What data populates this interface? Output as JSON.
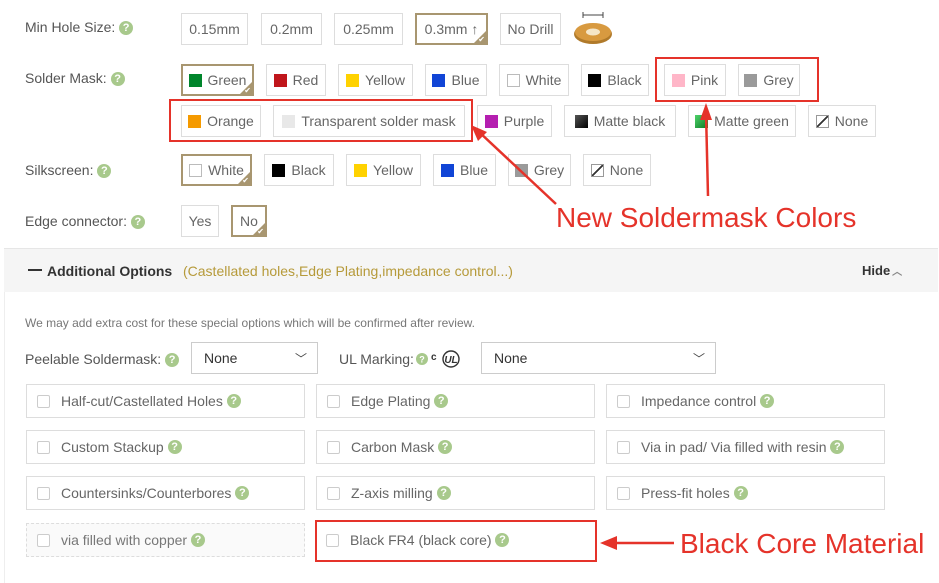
{
  "min_hole": {
    "label": "Min Hole Size:",
    "options": [
      "0.15mm",
      "0.2mm",
      "0.25mm",
      "0.3mm ↑",
      "No Drill"
    ],
    "selected": "0.3mm ↑"
  },
  "solder_mask": {
    "label": "Solder Mask:",
    "options": [
      {
        "label": "Green",
        "color": "#00852b"
      },
      {
        "label": "Red",
        "color": "#c0161b"
      },
      {
        "label": "Yellow",
        "color": "#ffd200"
      },
      {
        "label": "Blue",
        "color": "#1145d6"
      },
      {
        "label": "White",
        "color": "#ffffff"
      },
      {
        "label": "Black",
        "color": "#000000"
      },
      {
        "label": "Pink",
        "color": "#ffb6c8"
      },
      {
        "label": "Grey",
        "color": "#9a9a9a"
      },
      {
        "label": "Orange",
        "color": "#f59a00"
      },
      {
        "label": "Transparent solder mask",
        "color": "#e8e8e8"
      },
      {
        "label": "Purple",
        "color": "#b51fb0"
      },
      {
        "label": "Matte black",
        "color": "#1b1b1b"
      },
      {
        "label": "Matte green",
        "color": "#1fa33a"
      },
      {
        "label": "None",
        "color": "none"
      }
    ],
    "selected": "Green"
  },
  "silkscreen": {
    "label": "Silkscreen:",
    "options": [
      {
        "label": "White",
        "color": "#ffffff"
      },
      {
        "label": "Black",
        "color": "#000000"
      },
      {
        "label": "Yellow",
        "color": "#ffd200"
      },
      {
        "label": "Blue",
        "color": "#1145d6"
      },
      {
        "label": "Grey",
        "color": "#9a9a9a"
      },
      {
        "label": "None",
        "color": "none"
      }
    ],
    "selected": "White"
  },
  "edge_connector": {
    "label": "Edge connector:",
    "options": [
      "Yes",
      "No"
    ],
    "selected": "No"
  },
  "help_glyph": "?",
  "additional": {
    "title": "Additional Options",
    "subtitle": "(Castellated holes,Edge Plating,impedance control...)",
    "hide_label": "Hide",
    "note": "We may add extra cost for these special options which will be confirmed after review.",
    "peelable_label": "Peelable Soldermask:",
    "peelable_value": "None",
    "ul_label": "UL Marking:",
    "ul_value": "None",
    "checkboxes": [
      "Half-cut/Castellated Holes",
      "Edge Plating",
      "Impedance control",
      "Custom Stackup",
      "Carbon Mask",
      "Via in pad/ Via filled with resin",
      "Countersinks/Counterbores",
      "Z-axis milling",
      "Press-fit holes",
      "via filled with copper",
      "Black FR4 (black core)"
    ]
  },
  "annotations": {
    "new_colors": "New Soldermask Colors",
    "black_core": "Black Core Material"
  },
  "colors": {
    "annotation_red": "#e5332a",
    "selected_border": "#a89670",
    "help_green": "#a8c98c"
  }
}
